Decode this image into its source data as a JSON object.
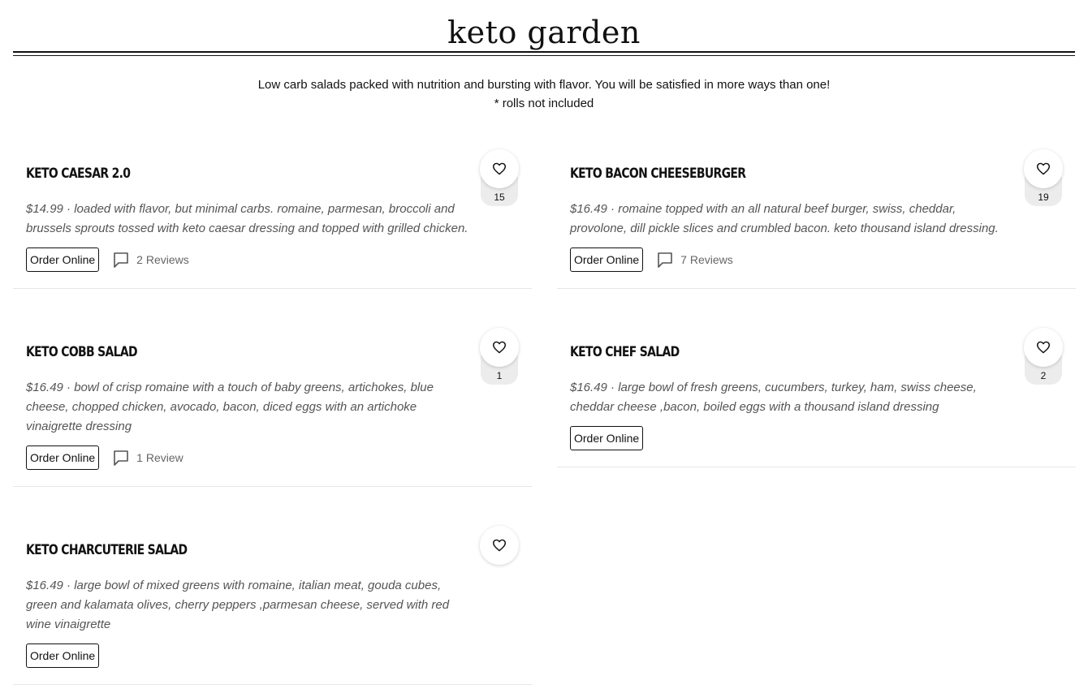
{
  "restaurant": {
    "title": "keto garden",
    "intro_line1": "Low carb salads packed with nutrition and bursting with flavor. You will be satisfied in more ways than one!",
    "intro_line2": "* rolls not included"
  },
  "items": [
    {
      "name": "KETO CAESAR 2.0",
      "desc": "$14.99 · loaded with flavor, but minimal carbs. romaine, parmesan, broccoli and brussels sprouts tossed with keto caesar dressing and topped with grilled chicken.",
      "likes": "15",
      "order_label": "Order Online",
      "reviews_label": "2 Reviews"
    },
    {
      "name": "KETO BACON CHEESEBURGER",
      "desc": "$16.49 · romaine topped with an all natural beef burger, swiss, cheddar, provolone, dill pickle slices and crumbled bacon. keto thousand island dressing.",
      "likes": "19",
      "order_label": "Order Online",
      "reviews_label": "7 Reviews"
    },
    {
      "name": "KETO COBB SALAD",
      "desc_lines": [
        "$16.49 · bowl of crisp romaine with a touch of baby greens, artichokes, blue cheese, chopped chicken, avocado, bacon, diced eggs with an artichoke",
        "vinaigrette dressing"
      ],
      "likes": "1",
      "order_label": "Order Online",
      "reviews_label": "1 Review"
    },
    {
      "name": "KETO CHEF SALAD",
      "desc": "$16.49 · large bowl of fresh greens, cucumbers, turkey, ham, swiss cheese, cheddar cheese ,bacon, boiled eggs with a thousand island dressing",
      "likes": "2",
      "order_label": "Order Online"
    },
    {
      "name": "KETO CHARCUTERIE SALAD",
      "desc_lines": [
        "$16.49 · large bowl of mixed greens with romaine, italian meat, gouda cubes, green and kalamata olives, cherry peppers ,parmesan cheese, served with red",
        "wine vinaigrette"
      ],
      "order_label": "Order Online"
    }
  ],
  "icons": {
    "like": "heart-outline-icon",
    "reviews": "speech-bubble-icon"
  }
}
